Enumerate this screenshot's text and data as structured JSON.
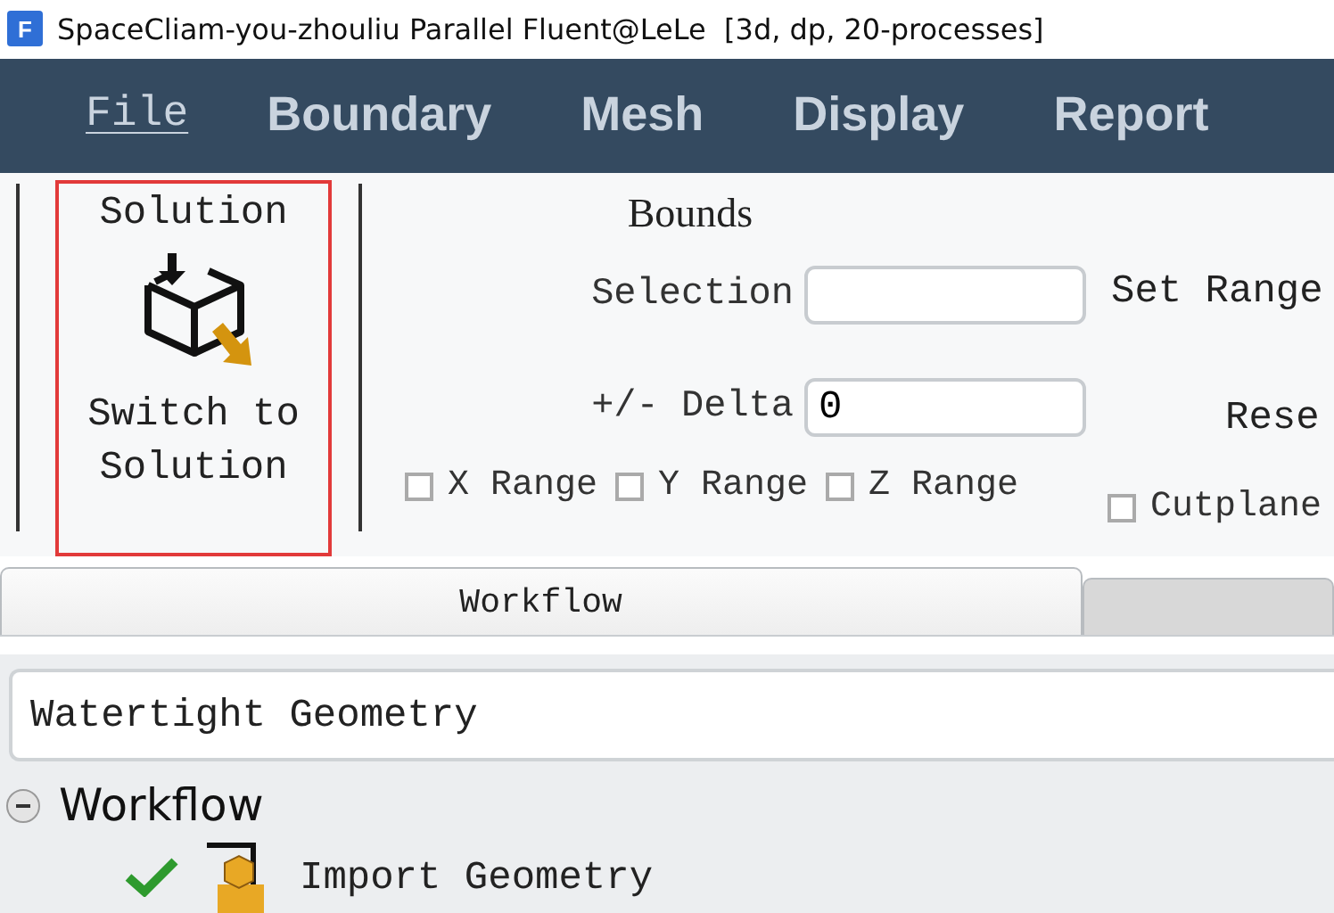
{
  "window": {
    "logo": "F",
    "title": "SpaceCliam-you-zhouliu Parallel Fluent@LeLe  [3d, dp, 20-processes]"
  },
  "menu": [
    {
      "label": "File",
      "kind": "file"
    },
    {
      "label": "Boundary",
      "kind": "main"
    },
    {
      "label": "Mesh",
      "kind": "main"
    },
    {
      "label": "Display",
      "kind": "main"
    },
    {
      "label": "Report",
      "kind": "main"
    }
  ],
  "ribbon": {
    "solution": {
      "title": "Solution",
      "button": "Switch to Solution",
      "highlighted": true
    },
    "bounds": {
      "title": "Bounds",
      "fields": [
        {
          "label": "Selection"
        },
        {
          "label": "+/- Delta",
          "value": "0"
        }
      ],
      "checkboxes": [
        {
          "label": "X Range",
          "checked": false
        },
        {
          "label": "Y Range",
          "checked": false
        },
        {
          "label": "Z Range",
          "checked": false
        }
      ]
    },
    "side": {
      "set_button": "Set Range",
      "reset_button": "Rese",
      "cutplane": {
        "label": "Cutplane",
        "checked": false
      }
    }
  },
  "tabs": [
    {
      "label": "Workflow",
      "selected": true
    },
    {
      "selected": false
    }
  ],
  "workflow_type": {
    "value": "Watertight Geometry"
  },
  "tree": [
    {
      "label": "Workflow",
      "expanded": true,
      "children": [
        {
          "label": "Import Geometry",
          "done": true
        }
      ]
    }
  ]
}
